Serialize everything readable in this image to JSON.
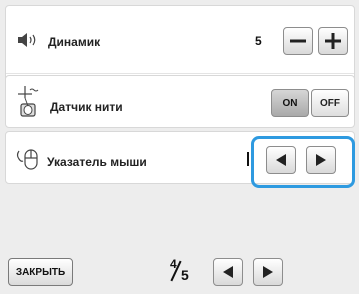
{
  "settings": {
    "speaker": {
      "label": "Динамик",
      "value": "5",
      "minus_icon": "minus-icon",
      "plus_icon": "plus-icon"
    },
    "thread_sensor": {
      "label": "Датчик нити",
      "on_label": "ON",
      "off_label": "OFF",
      "selected": "ON"
    },
    "mouse_pointer": {
      "label": "Указатель мыши",
      "left_icon": "triangle-left-icon",
      "right_icon": "triangle-right-icon"
    }
  },
  "footer": {
    "close_label": "ЗАКРЫТЬ",
    "page_current": "4",
    "page_total": "5"
  },
  "colors": {
    "highlight": "#2e9ae0",
    "background": "#ededed"
  }
}
